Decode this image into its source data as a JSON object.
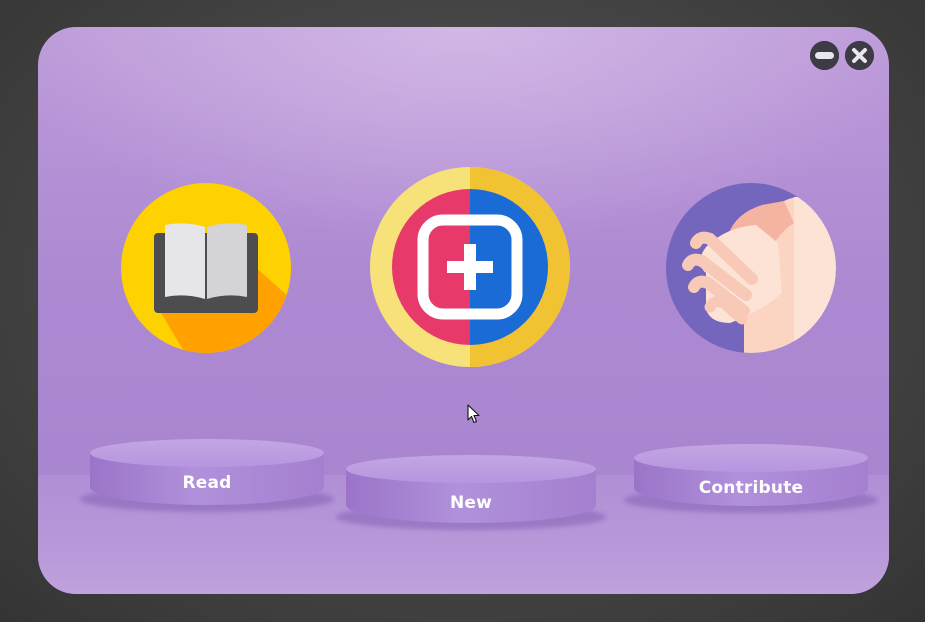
{
  "window": {
    "controls": [
      {
        "name": "minimize",
        "icon": "minimize-icon"
      },
      {
        "name": "close",
        "icon": "close-icon"
      }
    ]
  },
  "options": [
    {
      "label": "Read",
      "icon": "open-book-icon"
    },
    {
      "label": "New",
      "icon": "add-square-icon"
    },
    {
      "label": "Contribute",
      "icon": "handshake-icon"
    }
  ],
  "colors": {
    "background": "#a884cf",
    "label_text": "#ffffff",
    "control_buttons": "#3c3b46"
  },
  "cursor": {
    "icon": "mouse-pointer-icon"
  }
}
